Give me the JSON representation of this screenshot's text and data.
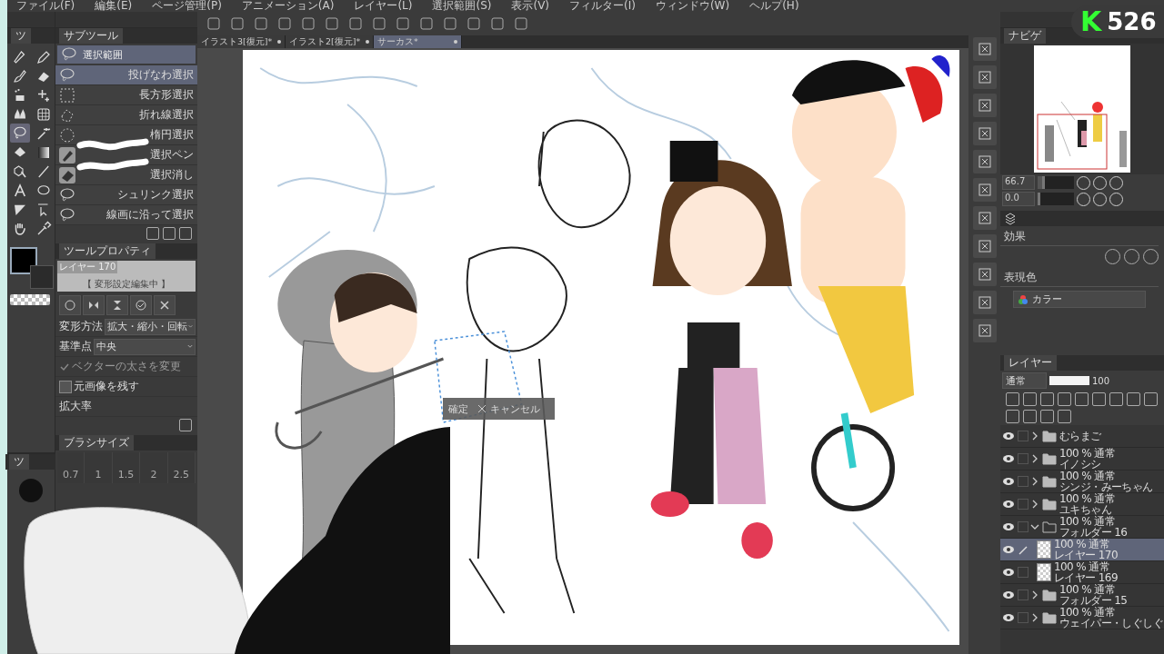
{
  "menu_bar": [
    "ファイル(F)",
    "編集(E)",
    "ページ管理(P)",
    "アニメーション(A)",
    "レイヤー(L)",
    "選択範囲(S)",
    "表示(V)",
    "フィルター(I)",
    "ウィンドウ(W)",
    "ヘルプ(H)"
  ],
  "document_tabs": [
    {
      "label": "イラスト3[復元]*",
      "selected": false
    },
    {
      "label": "イラスト2[復元]*",
      "selected": false
    },
    {
      "label": "サーカス*",
      "selected": true
    }
  ],
  "tool_palette": {
    "tab": "ツ",
    "tools": [
      {
        "kind": "pen",
        "selected": false
      },
      {
        "kind": "pencil",
        "selected": false
      },
      {
        "kind": "brush",
        "selected": false
      },
      {
        "kind": "eraser",
        "selected": false
      },
      {
        "kind": "airbrush",
        "selected": false
      },
      {
        "kind": "sparkle",
        "selected": false
      },
      {
        "kind": "blend",
        "selected": false
      },
      {
        "kind": "mesh",
        "selected": false
      },
      {
        "kind": "lasso",
        "selected": true
      },
      {
        "kind": "wand",
        "selected": false
      },
      {
        "kind": "fill",
        "selected": false
      },
      {
        "kind": "gradient",
        "selected": false
      },
      {
        "kind": "object",
        "selected": false
      },
      {
        "kind": "line",
        "selected": false
      },
      {
        "kind": "text",
        "selected": false
      },
      {
        "kind": "balloon",
        "selected": false
      },
      {
        "kind": "ruler",
        "selected": false
      },
      {
        "kind": "pointer",
        "selected": false
      },
      {
        "kind": "hand",
        "selected": false
      },
      {
        "kind": "eyedropper",
        "selected": false
      }
    ]
  },
  "subtool_panel": {
    "tab": "サブツール",
    "group": {
      "label": "選択範囲",
      "selected": true
    },
    "items": [
      {
        "label": "投げなわ選択",
        "kind": "lasso",
        "selected": true
      },
      {
        "label": "長方形選択",
        "kind": "rect",
        "selected": false
      },
      {
        "label": "折れ線選択",
        "kind": "polyline",
        "selected": false
      },
      {
        "label": "楕円選択",
        "kind": "ellipse",
        "selected": false
      },
      {
        "label": "選択ペン",
        "kind": "pen",
        "selected": false
      },
      {
        "label": "選択消し",
        "kind": "eraser",
        "selected": false
      },
      {
        "label": "シュリンク選択",
        "kind": "lasso",
        "selected": false
      },
      {
        "label": "線画に沿って選択",
        "kind": "lasso",
        "selected": false
      }
    ]
  },
  "tool_property": {
    "tab": "ツールプロパティ",
    "preview_layer": "レイヤー 170",
    "preview_status": "【 変形設定編集中 】",
    "rows": [
      {
        "kind": "dropdown",
        "label": "変形方法",
        "value": "拡大・縮小・回転"
      },
      {
        "kind": "dropdown",
        "label": "基準点",
        "value": "中央"
      },
      {
        "kind": "check",
        "label": "ベクターの太さを変更",
        "checked": true,
        "disabled": true
      },
      {
        "kind": "check",
        "label": "元画像を残す",
        "checked": false,
        "disabled": false
      },
      {
        "kind": "heading",
        "label": "拡大率"
      }
    ]
  },
  "brush_size": {
    "tab": "ブラシサイズ",
    "sizes": [
      "0.7",
      "1",
      "1.5",
      "2",
      "2.5"
    ]
  },
  "lower_tool_tab": "ツ",
  "transform_bar": {
    "confirm": "確定",
    "cancel": "キャンセル"
  },
  "navigator": {
    "tab": "ナビゲ",
    "zoom": {
      "value": "66.7",
      "level": 0.2
    },
    "rotation": {
      "value": "0.0",
      "level": 0.02
    }
  },
  "layer_property": {
    "effect_label": "効果",
    "color_label": "表現色",
    "color_mode": "カラー"
  },
  "layer_panel": {
    "tab": "レイヤー",
    "blend_mode": "通常",
    "opacity": {
      "value": "100",
      "level": 1
    },
    "layers": [
      {
        "name": "むらまご",
        "kind": "folder",
        "expanded": false,
        "selected": false
      },
      {
        "mode": "100 % 通常",
        "name": "イノシシ",
        "kind": "folder",
        "expanded": false,
        "selected": false
      },
      {
        "mode": "100 % 通常",
        "name": "シンジ・みーちゃん",
        "kind": "folder",
        "expanded": false,
        "selected": false
      },
      {
        "mode": "100 % 通常",
        "name": "ユキちゃん",
        "kind": "folder",
        "expanded": false,
        "selected": false
      },
      {
        "mode": "100 % 通常",
        "name": "フォルダー 16",
        "kind": "folder",
        "expanded": true,
        "selected": false,
        "children": [
          {
            "mode": "100 % 通常",
            "name": "レイヤー 170",
            "kind": "raster",
            "selected": true
          },
          {
            "mode": "100 % 通常",
            "name": "レイヤー 169",
            "kind": "raster",
            "selected": false
          }
        ]
      },
      {
        "mode": "100 % 通常",
        "name": "フォルダー 15",
        "kind": "folder",
        "expanded": false,
        "selected": false
      },
      {
        "mode": "100 % 通常",
        "name": "ウェイパー・しぐしぐ",
        "kind": "folder",
        "expanded": false,
        "selected": false
      }
    ]
  },
  "stream_overlay": {
    "logo": "K",
    "counter": "526"
  }
}
